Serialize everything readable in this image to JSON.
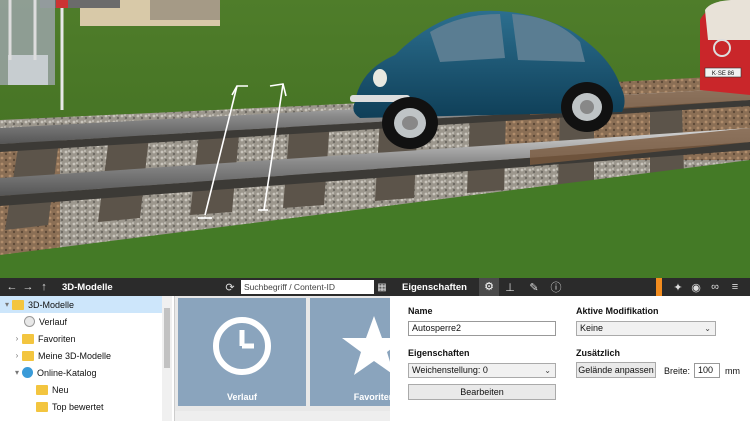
{
  "left_header": {
    "title": "3D-Modelle",
    "search_placeholder": "Suchbegriff / Content-ID"
  },
  "right_header": {
    "title": "Eigenschaften",
    "accent_color": "#f28c1e"
  },
  "tree": {
    "items": [
      {
        "label": "3D-Modelle",
        "selected": true
      },
      {
        "label": "Verlauf"
      },
      {
        "label": "Favoriten"
      },
      {
        "label": "Meine 3D-Modelle"
      },
      {
        "label": "Online-Katalog"
      },
      {
        "label": "Neu"
      },
      {
        "label": "Top bewertet"
      }
    ]
  },
  "tiles": [
    {
      "label": "Verlauf",
      "icon": "clock-icon"
    },
    {
      "label": "Favoriten",
      "icon": "star-icon"
    }
  ],
  "properties": {
    "name_label": "Name",
    "name_value": "Autosperre2",
    "eigenschaften_label": "Eigenschaften",
    "eigenschaften_value": "Weichenstellung: 0",
    "bearbeiten_label": "Bearbeiten",
    "aktive_label": "Aktive Modifikation",
    "aktive_value": "Keine",
    "zusaetzlich_label": "Zusätzlich",
    "gelaende_label": "Gelände anpassen",
    "breite_label": "Breite:",
    "breite_value": "100",
    "unit": "mm"
  },
  "scene": {
    "license_plate": "K·SE 86"
  }
}
